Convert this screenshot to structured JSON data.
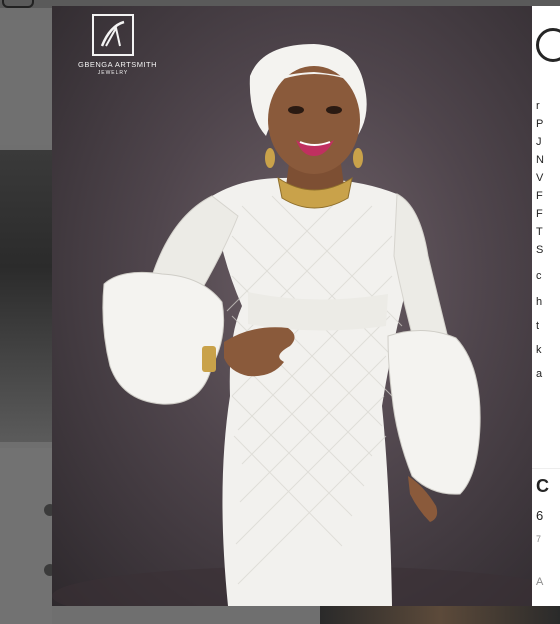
{
  "logo": {
    "name": "GBENGA ARTSMITH",
    "sub": "JEWELRY"
  },
  "caption_fragments": [
    "r",
    "P",
    "J",
    "N",
    "V",
    "F",
    "F",
    "T",
    "S",
    "c",
    "h",
    "t",
    "k",
    "a"
  ],
  "likes": "C",
  "counts": "6",
  "timestamp": "7",
  "add_comment": "A",
  "colors": {
    "backdrop": "#6f6f6f",
    "panel": "#ffffff",
    "dress": "#f2f1ee",
    "skin": "#8a5a3b"
  }
}
